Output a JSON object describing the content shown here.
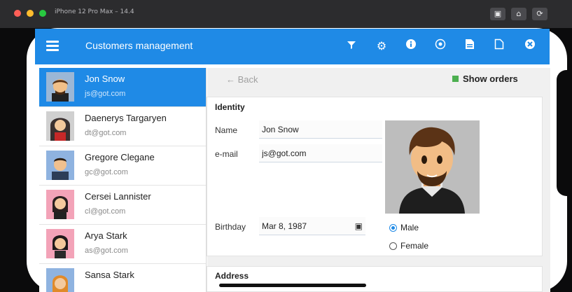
{
  "simulator": {
    "device_title": "iPhone 12 Pro Max – 14.4",
    "buttons": [
      "screenshot-icon",
      "home-icon",
      "rotate-icon"
    ]
  },
  "app": {
    "title": "Customers management",
    "accent": "#1f8ae6",
    "toolbar_icons": [
      "filter-icon",
      "gear-icon",
      "info-icon",
      "globe-icon",
      "document-filled-icon",
      "document-outline-icon",
      "close-circle-icon"
    ]
  },
  "customers": [
    {
      "name": "Jon Snow",
      "email": "js@got.com",
      "selected": true
    },
    {
      "name": "Daenerys Targaryen",
      "email": "dt@got.com",
      "selected": false
    },
    {
      "name": "Gregore Clegane",
      "email": "gc@got.com",
      "selected": false
    },
    {
      "name": "Cersei Lannister",
      "email": "cl@got.com",
      "selected": false
    },
    {
      "name": "Arya Stark",
      "email": "as@got.com",
      "selected": false
    },
    {
      "name": "Sansa Stark",
      "email": "",
      "selected": false
    }
  ],
  "detail": {
    "back_label": "← Back",
    "show_orders_label": "Show orders",
    "identity_label": "Identity",
    "name_label": "Name",
    "name_value": "Jon Snow",
    "email_label": "e-mail",
    "email_value": "js@got.com",
    "birthday_label": "Birthday",
    "birthday_value": "Mar 8, 1987",
    "gender_options": [
      "Male",
      "Female"
    ],
    "gender_selected": "Male",
    "address_label": "Address"
  }
}
